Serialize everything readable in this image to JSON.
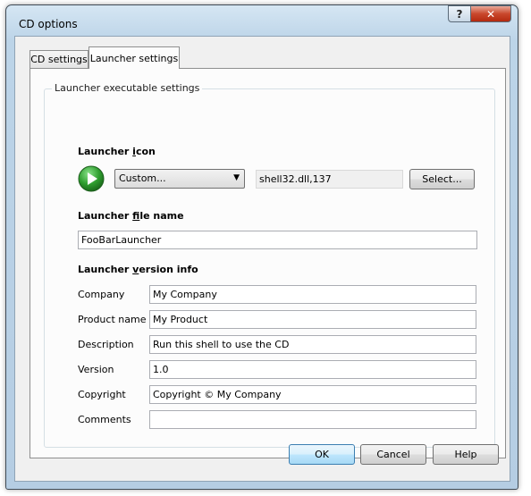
{
  "window": {
    "title": "CD options",
    "help_glyph": "?",
    "close_glyph": "✕"
  },
  "tabs": [
    {
      "label": "CD settings",
      "selected": false
    },
    {
      "label": "Launcher settings",
      "selected": true
    }
  ],
  "group": {
    "label": "Launcher executable settings"
  },
  "launcher_icon": {
    "heading": "Launcher icon",
    "combo_value": "Custom...",
    "combo_arrow": "▼",
    "icon_path": "shell32.dll,137",
    "select_button": "Select..."
  },
  "launcher_file": {
    "heading": "Launcher file name",
    "value": "FooBarLauncher"
  },
  "version_info": {
    "heading": "Launcher version info",
    "fields": [
      {
        "label": "Company",
        "value": "My Company"
      },
      {
        "label": "Product name",
        "value": "My Product"
      },
      {
        "label": "Description",
        "value": "Run this shell to use the CD"
      },
      {
        "label": "Version",
        "value": "1.0"
      },
      {
        "label": "Copyright",
        "value": "Copyright © My Company"
      },
      {
        "label": "Comments",
        "value": ""
      }
    ]
  },
  "buttons": {
    "ok": "OK",
    "cancel": "Cancel",
    "help": "Help"
  },
  "colors": {
    "title_bar": "#bcd4e8",
    "close_button": "#c9472c",
    "play_icon": "#2f9e2f",
    "default_button": "#3c7fb1"
  },
  "icons": {
    "launcher_icon": "play-icon"
  }
}
